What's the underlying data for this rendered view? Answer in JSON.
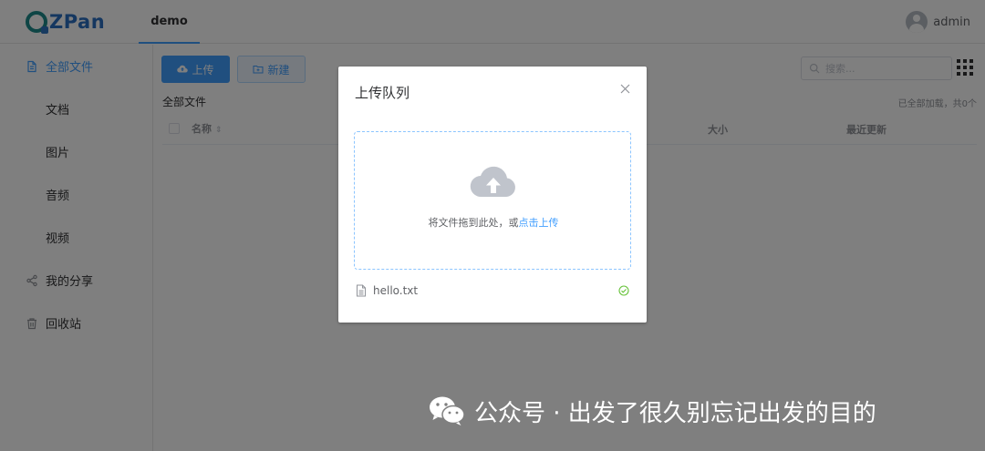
{
  "header": {
    "logo_text": "ZPan",
    "active_tab": "demo",
    "username": "admin"
  },
  "sidebar": {
    "items": [
      {
        "label": "全部文件",
        "icon": "document-icon",
        "active": true
      },
      {
        "label": "文档",
        "icon": ""
      },
      {
        "label": "图片",
        "icon": ""
      },
      {
        "label": "音频",
        "icon": ""
      },
      {
        "label": "视频",
        "icon": ""
      },
      {
        "label": "我的分享",
        "icon": "share-icon"
      },
      {
        "label": "回收站",
        "icon": "trash-icon"
      }
    ]
  },
  "toolbar": {
    "upload_label": "上传",
    "new_label": "新建",
    "search_placeholder": "搜索..."
  },
  "main": {
    "breadcrumb": "全部文件",
    "load_status": "已全部加载，共0个",
    "columns": {
      "name": "名称",
      "size": "大小",
      "updated": "最近更新"
    }
  },
  "dialog": {
    "title": "上传队列",
    "drop_text": "将文件拖到此处，或",
    "drop_link": "点击上传",
    "files": [
      {
        "name": "hello.txt",
        "status": "success"
      }
    ]
  },
  "watermark": {
    "text": "公众号 · 出发了很久别忘记出发的目的"
  },
  "colors": {
    "primary": "#409eff",
    "success": "#67c23a",
    "overlay": "rgba(0,0,0,0.5)"
  }
}
